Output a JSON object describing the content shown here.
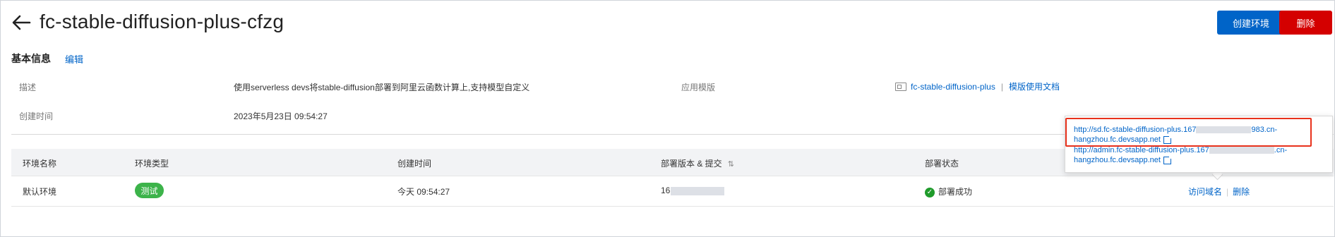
{
  "header": {
    "title": "fc-stable-diffusion-plus-cfzg",
    "create_env_label": "创建环境",
    "delete_label": "删除"
  },
  "basic_info": {
    "section_title": "基本信息",
    "edit_label": "编辑",
    "desc_label": "描述",
    "desc_value": "使用serverless devs将stable-diffusion部署到阿里云函数计算上,支持模型自定义",
    "app_template_label": "应用模版",
    "template_link": "fc-stable-diffusion-plus",
    "template_doc_link": "模版使用文档",
    "separator": "|",
    "created_label": "创建时间",
    "created_value": "2023年5月23日 09:54:27"
  },
  "table": {
    "columns": [
      "环境名称",
      "环境类型",
      "创建时间",
      "部署版本 & 提交",
      "部署状态"
    ],
    "sort_icon": "⇅",
    "rows": [
      {
        "env_name": "默认环境",
        "env_type": "测试",
        "created": "今天 09:54:27",
        "version": "16",
        "status": "部署成功",
        "action_domain": "访问域名",
        "action_delete": "删除"
      }
    ]
  },
  "popover": {
    "url1_line1_prefix": "http://sd.fc-stable-diffusion-plus.167",
    "url1_line1_suffix": "983.cn-",
    "url1_line2": "hangzhou.fc.devsapp.net",
    "url2_line1_prefix": "http://admin.fc-stable-diffusion-plus.167",
    "url2_line1_suffix": ".cn-",
    "url2_line2": "hangzhou.fc.devsapp.net"
  },
  "icons": {
    "back": "arrow-left-icon",
    "template": "template-icon",
    "success": "check-circle-icon",
    "external": "external-link-icon"
  },
  "colors": {
    "primary": "#0064c8",
    "danger": "#d40000",
    "success": "#3cb34a",
    "highlight": "#e8321c"
  }
}
